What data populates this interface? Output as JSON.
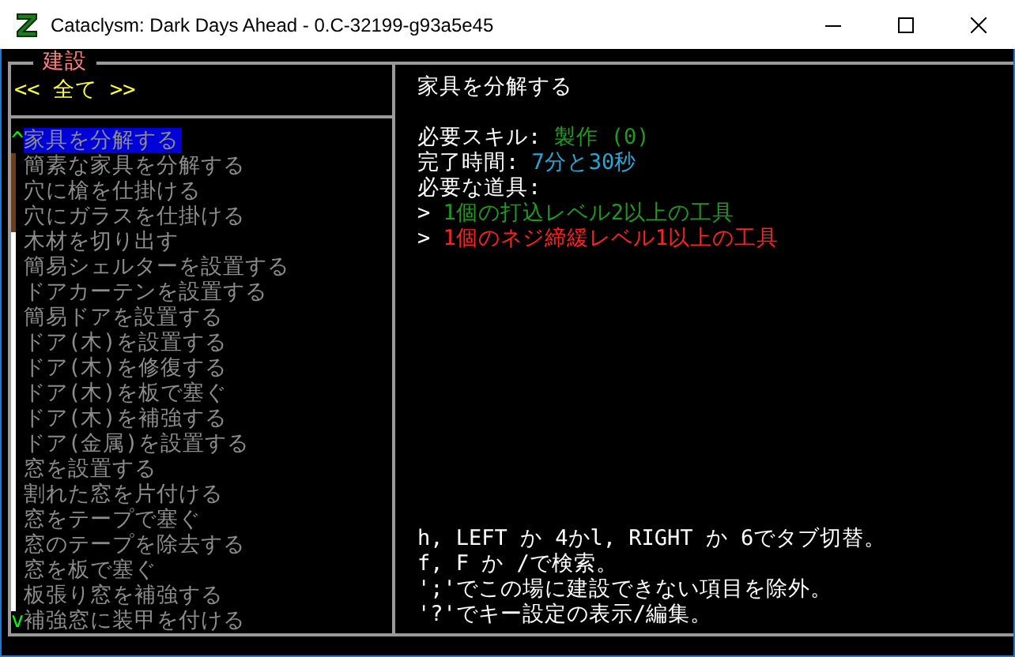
{
  "window": {
    "title": "Cataclysm: Dark Days Ahead - 0.C-32199-g93a5e45"
  },
  "menu": {
    "title": "建設",
    "filter": "<< 全て >>",
    "scroll_up": "^",
    "scroll_down": "v",
    "items": [
      {
        "label": "家具を分解する",
        "selected": true
      },
      {
        "label": "簡素な家具を分解する",
        "selected": false
      },
      {
        "label": "穴に槍を仕掛ける",
        "selected": false
      },
      {
        "label": "穴にガラスを仕掛ける",
        "selected": false
      },
      {
        "label": "木材を切り出す",
        "selected": false
      },
      {
        "label": "簡易シェルターを設置する",
        "selected": false
      },
      {
        "label": "ドアカーテンを設置する",
        "selected": false
      },
      {
        "label": "簡易ドアを設置する",
        "selected": false
      },
      {
        "label": "ドア(木)を設置する",
        "selected": false
      },
      {
        "label": "ドア(木)を修復する",
        "selected": false
      },
      {
        "label": "ドア(木)を板で塞ぐ",
        "selected": false
      },
      {
        "label": "ドア(木)を補強する",
        "selected": false
      },
      {
        "label": "ドア(金属)を設置する",
        "selected": false
      },
      {
        "label": "窓を設置する",
        "selected": false
      },
      {
        "label": "割れた窓を片付ける",
        "selected": false
      },
      {
        "label": "窓をテープで塞ぐ",
        "selected": false
      },
      {
        "label": "窓のテープを除去する",
        "selected": false
      },
      {
        "label": "窓を板で塞ぐ",
        "selected": false
      },
      {
        "label": "板張り窓を補強する",
        "selected": false
      },
      {
        "label": "補強窓に装甲を付ける",
        "selected": false
      }
    ]
  },
  "detail": {
    "title": "家具を分解する",
    "skill_label": "必要スキル:",
    "skill_value": "製作 (0)",
    "time_label": "完了時間:",
    "time_value": "7分と30秒",
    "tools_label": "必要な道具:",
    "tools": [
      {
        "bullet": ">",
        "label": "1個の打込レベル2以上の工具",
        "available": true
      },
      {
        "bullet": ">",
        "label": "1個のネジ締緩レベル1以上の工具",
        "available": false
      }
    ]
  },
  "help": [
    "h, LEFT か 4かl, RIGHT か 6でタブ切替。",
    "f, F か /で検索。",
    "';'でこの場に建設できない項目を除外。",
    "'?'でキー設定の表示/編集。"
  ]
}
